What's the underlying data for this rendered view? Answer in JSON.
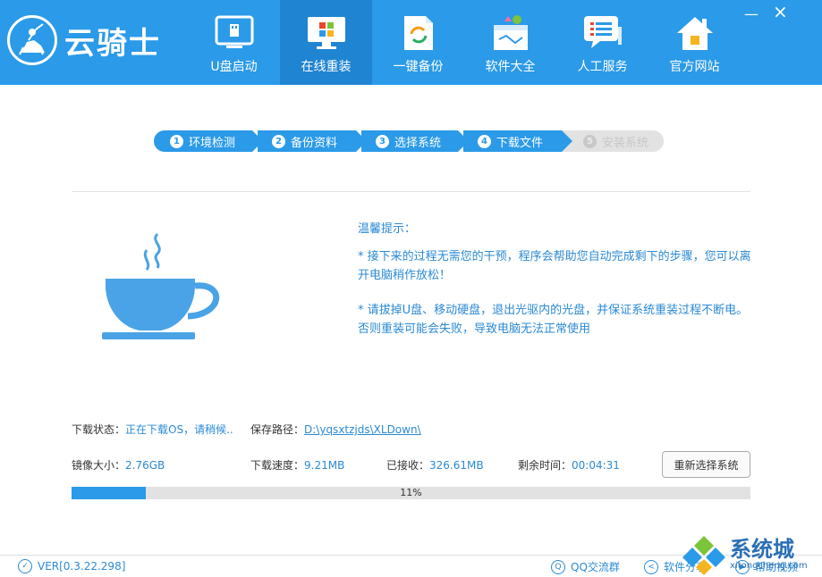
{
  "app": {
    "name": "云骑士"
  },
  "nav": {
    "items": [
      {
        "label": "U盘启动"
      },
      {
        "label": "在线重装"
      },
      {
        "label": "一键备份"
      },
      {
        "label": "软件大全"
      },
      {
        "label": "人工服务"
      },
      {
        "label": "官方网站"
      }
    ],
    "active_index": 1
  },
  "window": {
    "minimize": "—",
    "close": "×"
  },
  "steps": [
    {
      "num": "1",
      "label": "环境检测"
    },
    {
      "num": "2",
      "label": "备份资料"
    },
    {
      "num": "3",
      "label": "选择系统"
    },
    {
      "num": "4",
      "label": "下载文件"
    },
    {
      "num": "5",
      "label": "安装系统"
    }
  ],
  "tips": {
    "title": "温馨提示：",
    "para1": "* 接下来的过程无需您的干预，程序会帮助您自动完成剩下的步骤，您可以离开电脑稍作放松！",
    "para2": "* 请拔掉U盘、移动硬盘，退出光驱内的光盘，并保证系统重装过程不断电。否则重装可能会失败，导致电脑无法正常使用"
  },
  "status": {
    "download_state_label": "下载状态：",
    "download_state_value": "正在下载OS，请稍候..",
    "save_path_label": "保存路径：",
    "save_path_value": "D:\\yqsxtzjds\\XLDown\\",
    "image_size_label": "镜像大小：",
    "image_size_value": "2.76GB",
    "speed_label": "下载速度：",
    "speed_value": "9.21MB",
    "received_label": "已接收：",
    "received_value": "326.61MB",
    "remaining_label": "剩余时间：",
    "remaining_value": "00:04:31",
    "reselect_button": "重新选择系统"
  },
  "progress": {
    "percent": 11,
    "text": "11%"
  },
  "footer": {
    "version": "VER[0.3.22.298]",
    "qq_group": "QQ交流群",
    "share": "软件分享",
    "help": "帮助视频"
  },
  "watermark": {
    "cn": "系统城",
    "en": "xitongcheng.com"
  },
  "colors": {
    "primary": "#2b9ae8",
    "active_nav": "#1f84d2",
    "text_blue": "#2b8ad4"
  }
}
